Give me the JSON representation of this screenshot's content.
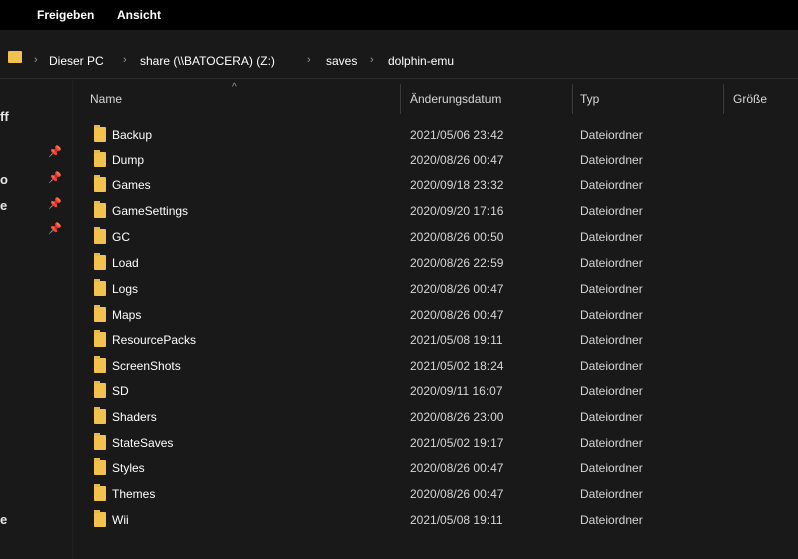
{
  "ribbon": {
    "share_label": "Freigeben",
    "view_label": "Ansicht"
  },
  "address": {
    "segments": [
      "Dieser PC",
      "share (\\\\BATOCERA) (Z:)",
      "saves",
      "dolphin-emu"
    ],
    "separator": "›"
  },
  "nav": {
    "fragments": [
      "ff",
      "o",
      "e",
      "e"
    ],
    "pin_glyph": "📌"
  },
  "columns": {
    "name": "Name",
    "date": "Änderungsdatum",
    "type": "Typ",
    "size": "Größe"
  },
  "rows": [
    {
      "name": "Backup",
      "date": "2021/05/06 23:42",
      "type": "Dateiordner"
    },
    {
      "name": "Dump",
      "date": "2020/08/26 00:47",
      "type": "Dateiordner"
    },
    {
      "name": "Games",
      "date": "2020/09/18 23:32",
      "type": "Dateiordner"
    },
    {
      "name": "GameSettings",
      "date": "2020/09/20 17:16",
      "type": "Dateiordner"
    },
    {
      "name": "GC",
      "date": "2020/08/26 00:50",
      "type": "Dateiordner"
    },
    {
      "name": "Load",
      "date": "2020/08/26 22:59",
      "type": "Dateiordner"
    },
    {
      "name": "Logs",
      "date": "2020/08/26 00:47",
      "type": "Dateiordner"
    },
    {
      "name": "Maps",
      "date": "2020/08/26 00:47",
      "type": "Dateiordner"
    },
    {
      "name": "ResourcePacks",
      "date": "2021/05/08 19:11",
      "type": "Dateiordner"
    },
    {
      "name": "ScreenShots",
      "date": "2021/05/02 18:24",
      "type": "Dateiordner"
    },
    {
      "name": "SD",
      "date": "2020/09/11 16:07",
      "type": "Dateiordner"
    },
    {
      "name": "Shaders",
      "date": "2020/08/26 23:00",
      "type": "Dateiordner"
    },
    {
      "name": "StateSaves",
      "date": "2021/05/02 19:17",
      "type": "Dateiordner"
    },
    {
      "name": "Styles",
      "date": "2020/08/26 00:47",
      "type": "Dateiordner"
    },
    {
      "name": "Themes",
      "date": "2020/08/26 00:47",
      "type": "Dateiordner"
    },
    {
      "name": "Wii",
      "date": "2021/05/08 19:11",
      "type": "Dateiordner"
    }
  ],
  "colors": {
    "background": "#191919",
    "ribbon": "#000000",
    "folder": "#f3c24e",
    "text": "#ffffff"
  },
  "icons": {
    "folder": "folder-icon",
    "pin": "pin-icon",
    "chevron": "chevron-right-icon"
  }
}
